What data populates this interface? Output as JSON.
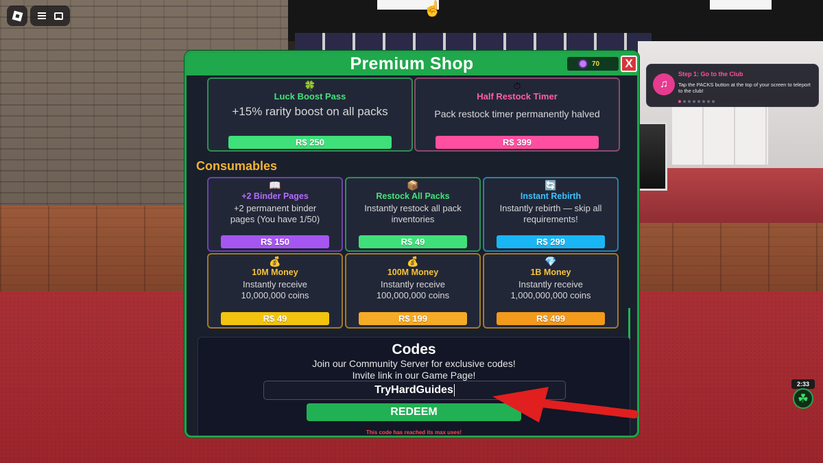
{
  "shop": {
    "title": "Premium Shop",
    "currency": "70",
    "close_label": "X",
    "passes": [
      {
        "icon": "🍀",
        "name": "Luck Boost Pass",
        "desc": "+15% rarity boost on all packs",
        "price": "R$ 250",
        "name_color": "#46e27a",
        "price_color": "#3fe07a",
        "border": "#2f8f55"
      },
      {
        "icon": "⏱",
        "name": "Half Restock Timer",
        "desc": "Pack restock timer permanently halved",
        "price": "R$ 399",
        "name_color": "#ff5fa6",
        "price_color": "#ff4fa0",
        "border": "#8a4a6a"
      }
    ],
    "consumables_title": "Consumables",
    "consumables": [
      {
        "icon": "📖",
        "name": "+2 Binder Pages",
        "desc1": "+2 permanent binder",
        "desc2": "pages (You have 1/50)",
        "price": "R$ 150",
        "name_color": "#b56bff",
        "price_color": "#a656f0",
        "border": "#6c45a8"
      },
      {
        "icon": "📦",
        "name": "Restock All Packs",
        "desc1": "Instantly restock all pack",
        "desc2": "inventories",
        "price": "R$ 49",
        "name_color": "#46e27a",
        "price_color": "#3fe07a",
        "border": "#2f8f55"
      },
      {
        "icon": "🔄",
        "name": "Instant Rebirth",
        "desc1": "Instantly rebirth — skip all",
        "desc2": "requirements!",
        "price": "R$ 299",
        "name_color": "#39c3ff",
        "price_color": "#19b6f5",
        "border": "#2d7fa6"
      },
      {
        "icon": "💰",
        "name": "10M Money",
        "desc1": "Instantly receive",
        "desc2": "10,000,000 coins",
        "price": "R$ 49",
        "name_color": "#f5c23a",
        "price_color": "#f2c40e",
        "border": "#a07a28"
      },
      {
        "icon": "💰",
        "name": "100M Money",
        "desc1": "Instantly receive",
        "desc2": "100,000,000 coins",
        "price": "R$ 199",
        "name_color": "#f5c23a",
        "price_color": "#f5ab25",
        "border": "#a07a28"
      },
      {
        "icon": "💎",
        "name": "1B Money",
        "desc1": "Instantly receive",
        "desc2": "1,000,000,000 coins",
        "price": "R$ 499",
        "name_color": "#f5c23a",
        "price_color": "#f39a1c",
        "border": "#a07a28"
      }
    ]
  },
  "codes": {
    "title": "Codes",
    "line1": "Join our Community Server for exclusive codes!",
    "line2": "Invite link in our Game Page!",
    "input_value": "TryHardGuides",
    "redeem_label": "REDEEM",
    "error": "This code has reached its max uses!"
  },
  "notification": {
    "title": "Step 1: Go to the Club",
    "body": "Tap the PACKS button at the top of your screen to teleport to the club!"
  },
  "hud": {
    "timer": "2:33"
  }
}
